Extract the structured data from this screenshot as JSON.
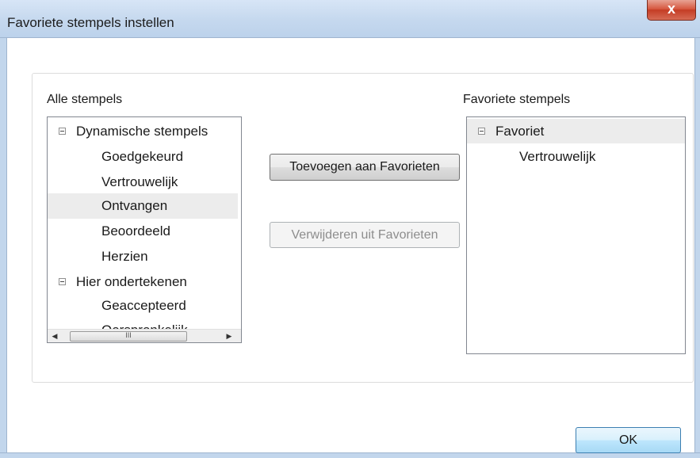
{
  "window": {
    "title": "Favoriete stempels instellen",
    "close_glyph": "x"
  },
  "left_panel": {
    "label": "Alle stempels",
    "tree": [
      {
        "label": "Dynamische stempels",
        "level": 0,
        "expanded": true
      },
      {
        "label": "Goedgekeurd",
        "level": 1
      },
      {
        "label": "Vertrouwelijk",
        "level": 1
      },
      {
        "label": "Ontvangen",
        "level": 1,
        "selected": true
      },
      {
        "label": "Beoordeeld",
        "level": 1
      },
      {
        "label": "Herzien",
        "level": 1
      },
      {
        "label": "Hier ondertekenen",
        "level": 0,
        "expanded": true
      },
      {
        "label": "Geaccepteerd",
        "level": 1
      },
      {
        "label": "Oorspronkelijk",
        "level": 1
      }
    ],
    "scroll_thumb_glyph": "≡",
    "hscroll_thumb_glyph": "III"
  },
  "buttons": {
    "add": "Toevoegen aan Favorieten",
    "remove": "Verwijderen uit Favorieten",
    "ok": "OK"
  },
  "right_panel": {
    "label": "Favoriete stempels",
    "tree": [
      {
        "label": "Favoriet",
        "level": 0,
        "expanded": true
      },
      {
        "label": "Vertrouwelijk",
        "level": 1
      }
    ]
  },
  "icons": {
    "expander": "minus-box-icon",
    "scroll_up": "arrow-up-icon",
    "scroll_down": "arrow-down-icon",
    "scroll_left": "arrow-left-icon",
    "scroll_right": "arrow-right-icon"
  },
  "colors": {
    "titlebar": "#c5d8ee",
    "close_button": "#c43c24",
    "selected_row": "#ececec"
  }
}
